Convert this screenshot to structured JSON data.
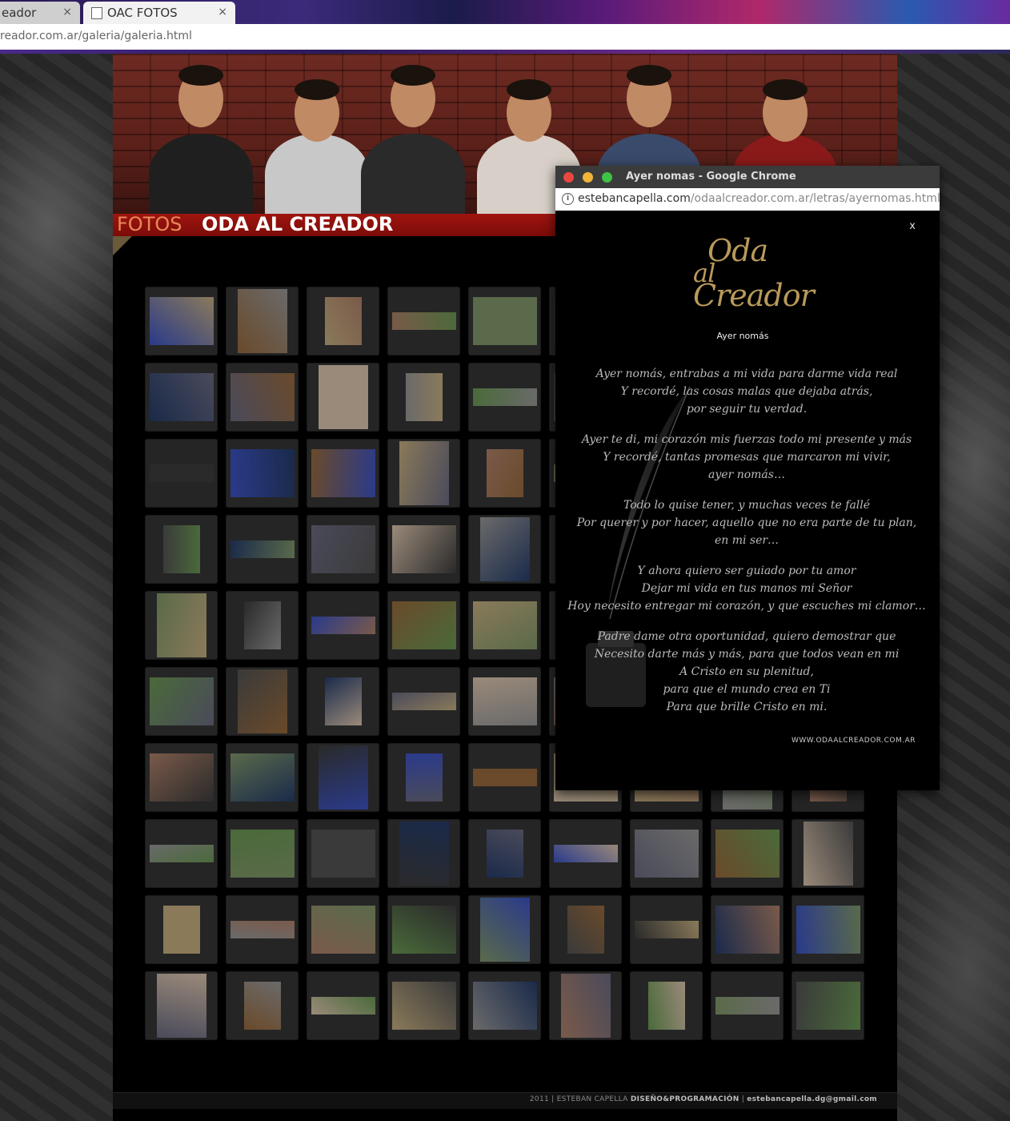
{
  "browser": {
    "tabs": [
      {
        "label": "eador",
        "close": "×"
      },
      {
        "label": "OAC FOTOS",
        "close": "×"
      }
    ],
    "url": "reador.com.ar/galeria/galeria.html"
  },
  "page": {
    "section_label": "FOTOS",
    "band_name": "ODA AL CREADOR",
    "footer": {
      "year": "2011",
      "separator": "|",
      "author": "ESTEBAN CAPELLA",
      "role": "DISEÑO&PROGRAMACIÓN",
      "email": "estebancapella.dg@gmail.com"
    }
  },
  "popup": {
    "window_title": "Ayer nomas - Google Chrome",
    "url_domain": "estebancapella.com",
    "url_path": "/odaalcreador.com.ar/letras/ayernomas.html",
    "close_label": "x",
    "logo_lines": [
      "Oda",
      "al",
      "Creador"
    ],
    "song_title": "Ayer nomás",
    "stanzas": [
      [
        "Ayer nomás, entrabas a mi vida para darme vida real",
        "Y recordé, las cosas malas que dejaba atrás,",
        "por seguir tu verdad."
      ],
      [
        "Ayer te di, mi corazón mis fuerzas todo mi presente y más",
        "Y recordé, tantas promesas que marcaron mi vivir,",
        "ayer nomás…"
      ],
      [
        "Todo lo quise tener, y muchas veces te fallé",
        "Por querer y por hacer, aquello que no era parte de tu plan,",
        "en mi ser…"
      ],
      [
        "Y ahora quiero ser guiado por tu amor",
        "Dejar mi vida en tus manos mi Señor",
        "Hoy necesito entregar mi corazón, y que escuches mi clamor…"
      ],
      [
        "Padre dame otra oportunidad, quiero demostrar que",
        "Necesito darte más y más, para que todos vean en mi",
        "A Cristo en su plenitud,",
        "para que el mundo crea en Ti",
        "Para que brille Cristo en mi."
      ]
    ],
    "site": "WWW.ODAALCREADOR.COM.AR"
  },
  "gallery": {
    "columns": 9,
    "rows": 10,
    "thumb_palette": [
      "#2a3a8a",
      "#4a6a3a",
      "#6a4a2a",
      "#3a3a3a",
      "#8a7a5a",
      "#1a2a4a",
      "#7a5a4a",
      "#4a4a5a",
      "#5a6a4a",
      "#9a8a7a",
      "#2a2a2a",
      "#6a6a6a"
    ]
  }
}
